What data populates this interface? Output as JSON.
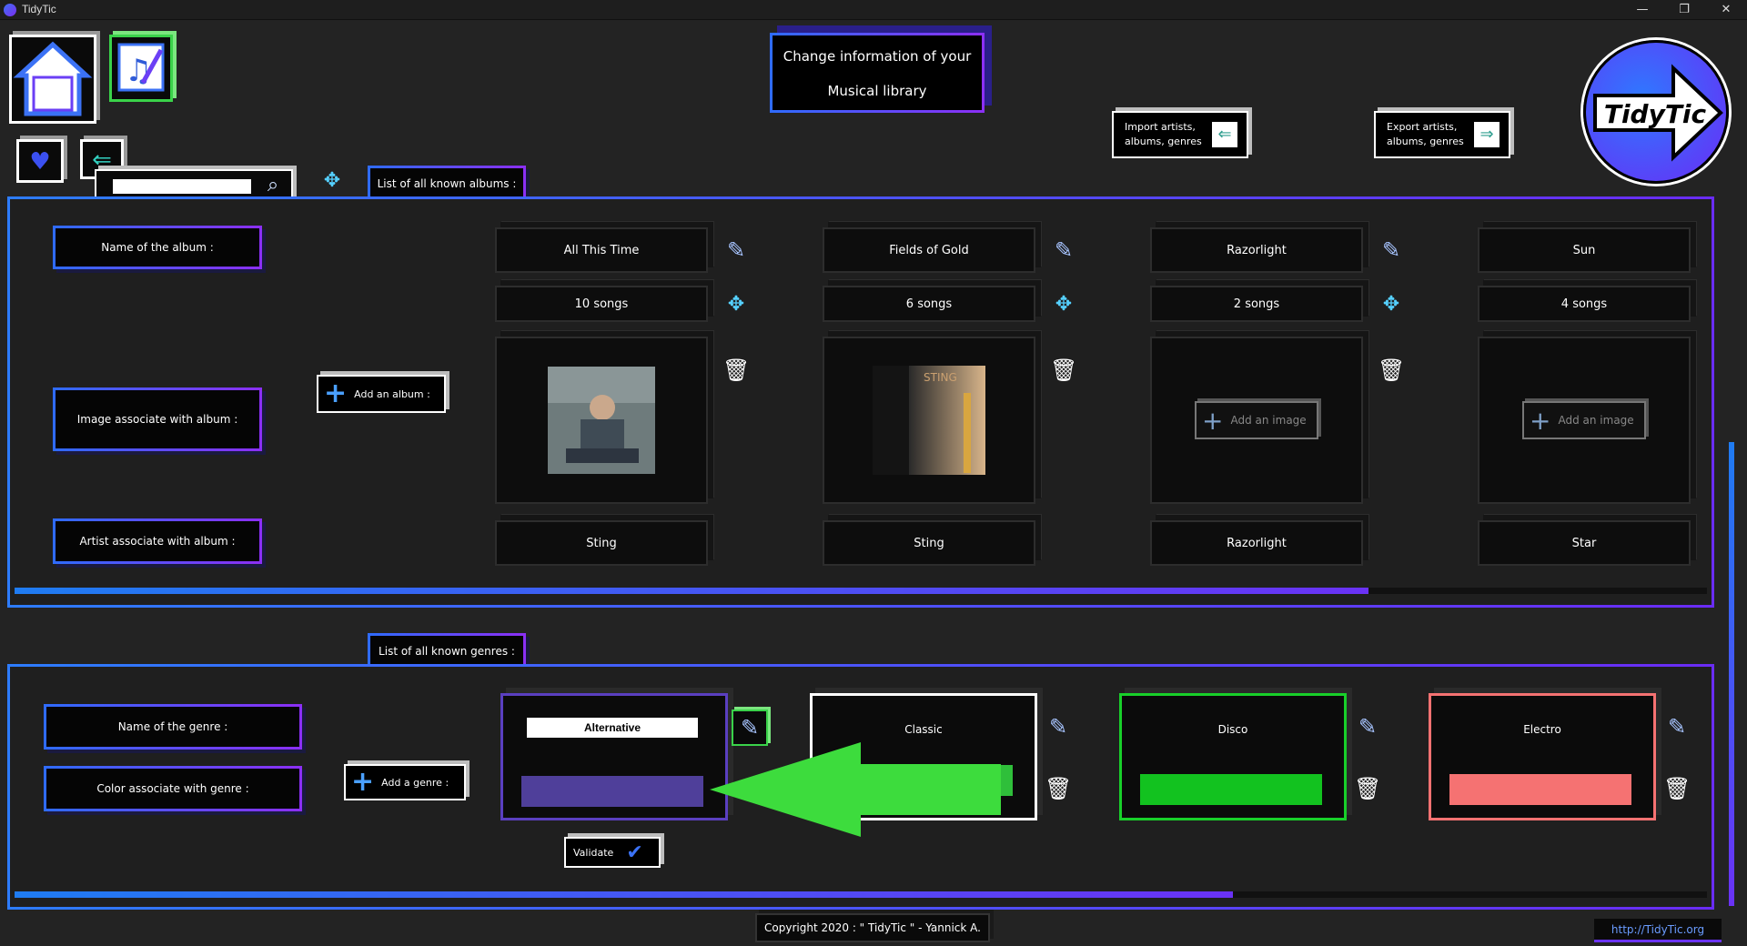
{
  "window": {
    "title": "TidyTic",
    "minimize": "—",
    "maximize": "❐",
    "close": "✕"
  },
  "header": {
    "title_line1": "Change information of your",
    "title_line2": "Musical library",
    "import_label_1": "Import artists,",
    "import_label_2": "albums, genres",
    "export_label_1": "Export artists,",
    "export_label_2": "albums, genres",
    "logo_text": "TidyTic"
  },
  "search": {
    "placeholder": ""
  },
  "albums": {
    "tab_label": "List of all known albums :",
    "row_labels": {
      "name": "Name of the album :",
      "image": "Image associate with album :",
      "artist": "Artist associate with album :"
    },
    "add_button": "Add an album :",
    "add_image_label": "Add an image",
    "items": [
      {
        "name": "All This Time",
        "songs": "10 songs",
        "artist": "Sting",
        "has_image": true
      },
      {
        "name": "Fields of Gold",
        "songs": "6 songs",
        "artist": "Sting",
        "has_image": true,
        "cover_text": "STING"
      },
      {
        "name": "Razorlight",
        "songs": "2 songs",
        "artist": "Razorlight",
        "has_image": false
      },
      {
        "name": "Sun",
        "songs": "4 songs",
        "artist": "Star",
        "has_image": false
      }
    ],
    "scroll_fraction": 0.8
  },
  "genres": {
    "tab_label": "List of all known genres :",
    "row_labels": {
      "name": "Name of the genre :",
      "color": "Color associate with genre :"
    },
    "add_button": "Add a genre :",
    "validate_label": "Validate",
    "items": [
      {
        "name": "Alternative",
        "color": "#4f3f9a",
        "border": "#5a3fc0",
        "editing": true
      },
      {
        "name": "Classic",
        "color": "#2fbf3a",
        "border": "#ffffff"
      },
      {
        "name": "Disco",
        "color": "#12c21f",
        "border": "#18d02a"
      },
      {
        "name": "Electro",
        "color": "#f57272",
        "border": "#f57272"
      }
    ],
    "scroll_fraction": 0.72
  },
  "footer": {
    "copyright": "Copyright 2020 : \" TidyTic \" - Yannick A.",
    "link": "http://TidyTic.org"
  },
  "colors": {
    "accent_blue": "#2d7cff",
    "accent_purple": "#7a2ff0",
    "annotation_arrow": "#3ddc3d"
  }
}
